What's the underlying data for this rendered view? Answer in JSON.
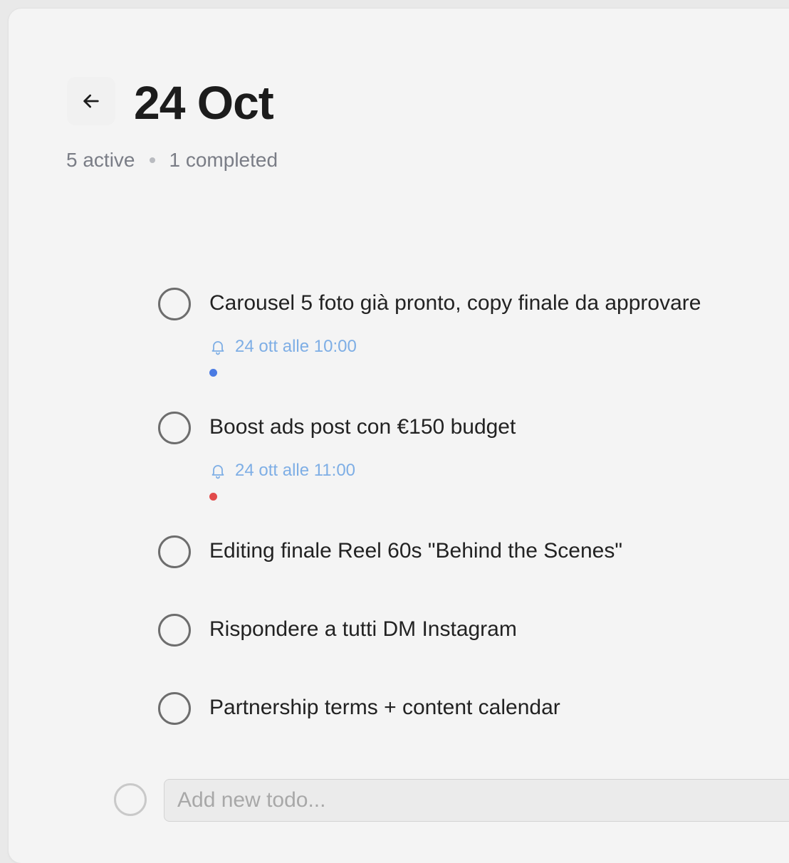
{
  "header": {
    "title": "24 Oct",
    "active_count": "5 active",
    "completed_count": "1 completed"
  },
  "todos": [
    {
      "text": "Carousel 5 foto già pronto, copy finale da approvare",
      "reminder": "24 ott alle 10:00",
      "tag_color": "#4a7be3"
    },
    {
      "text": "Boost ads post con €150 budget",
      "reminder": "24 ott alle 11:00",
      "tag_color": "#e24b4b"
    },
    {
      "text": "Editing finale Reel 60s \"Behind the Scenes\""
    },
    {
      "text": "Rispondere a tutti DM Instagram"
    },
    {
      "text": "Partnership terms + content calendar"
    }
  ],
  "new_todo": {
    "placeholder": "Add new todo..."
  },
  "colors": {
    "reminder": "#7eaee5",
    "checkbox": "#6d6d6d",
    "background": "#f4f4f4"
  }
}
